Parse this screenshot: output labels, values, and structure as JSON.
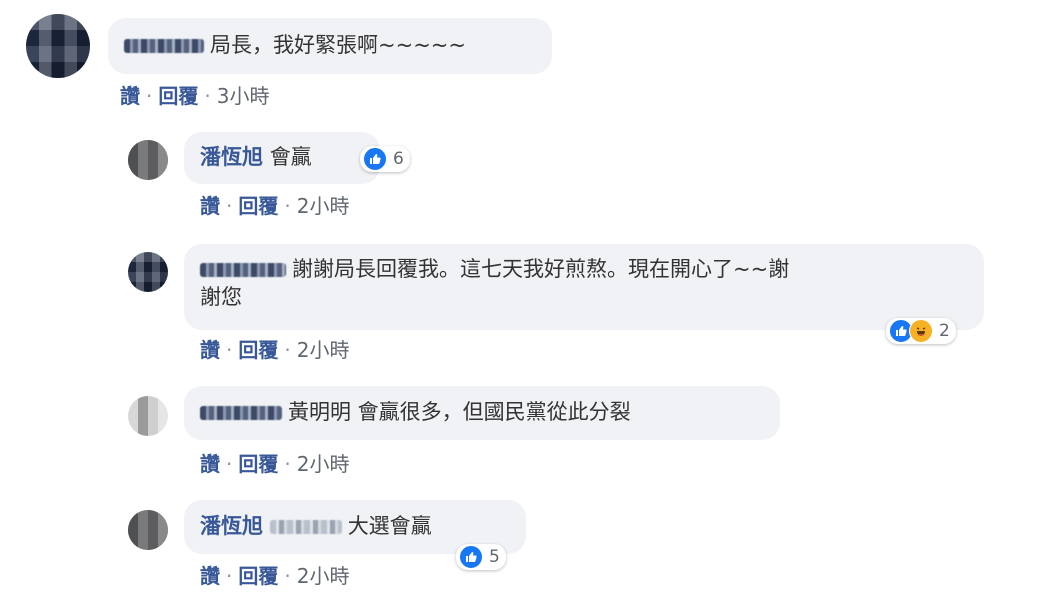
{
  "comments": [
    {
      "text": "局長，我好緊張啊~~~~~",
      "actions": {
        "like": "讚",
        "reply": "回覆",
        "time": "3小時"
      }
    },
    {
      "name": "潘恆旭",
      "text": "會贏",
      "reaction_count": "6",
      "actions": {
        "like": "讚",
        "reply": "回覆",
        "time": "2小時"
      }
    },
    {
      "text_line1": "謝謝局長回覆我。這七天我好煎熬。現在開心了~~謝",
      "text_line2": "謝您",
      "reaction_count": "2",
      "actions": {
        "like": "讚",
        "reply": "回覆",
        "time": "2小時"
      }
    },
    {
      "text": "黃明明 會贏很多，但國民黨從此分裂",
      "actions": {
        "like": "讚",
        "reply": "回覆",
        "time": "2小時"
      }
    },
    {
      "name": "潘恆旭",
      "text": "大選會贏",
      "reaction_count": "5",
      "actions": {
        "like": "讚",
        "reply": "回覆",
        "time": "2小時"
      }
    }
  ],
  "icons": {
    "like": "like-icon",
    "haha": "haha-icon"
  },
  "colors": {
    "name": "#385898",
    "bubble": "#f0f2f5",
    "like": "#1877f2",
    "haha": "#f7b125"
  }
}
